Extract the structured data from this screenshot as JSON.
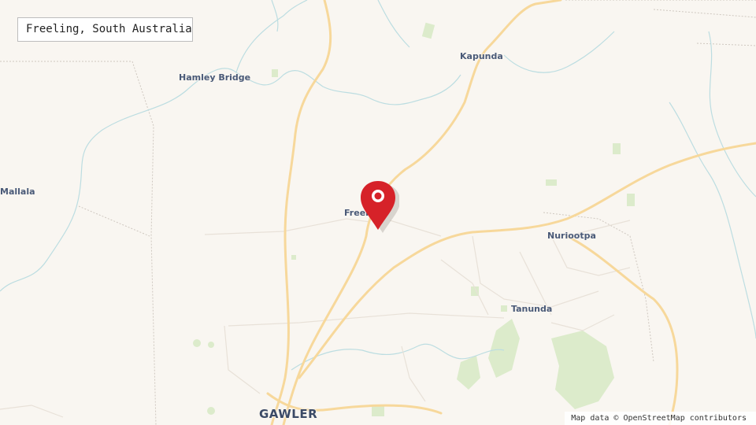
{
  "map": {
    "title": "Freeling, South Australia",
    "attribution": "Map data © OpenStreetMap contributors",
    "marker_icon": "location-pin-icon",
    "colors": {
      "land": "#f9f6f1",
      "road": "#f9dd9d",
      "minor_road": "#ffffff",
      "river": "#b7d9dd",
      "park": "#d9ebc8",
      "boundary": "#c9c3bc",
      "marker": "#d62229"
    },
    "places": {
      "kapunda": "Kapunda",
      "hamley_bridge": "Hamley Bridge",
      "mallala": "Mallala",
      "freeling": "Freeling",
      "nuriootpa": "Nuriootpa",
      "tanunda": "Tanunda",
      "gawler": "GAWLER"
    }
  }
}
